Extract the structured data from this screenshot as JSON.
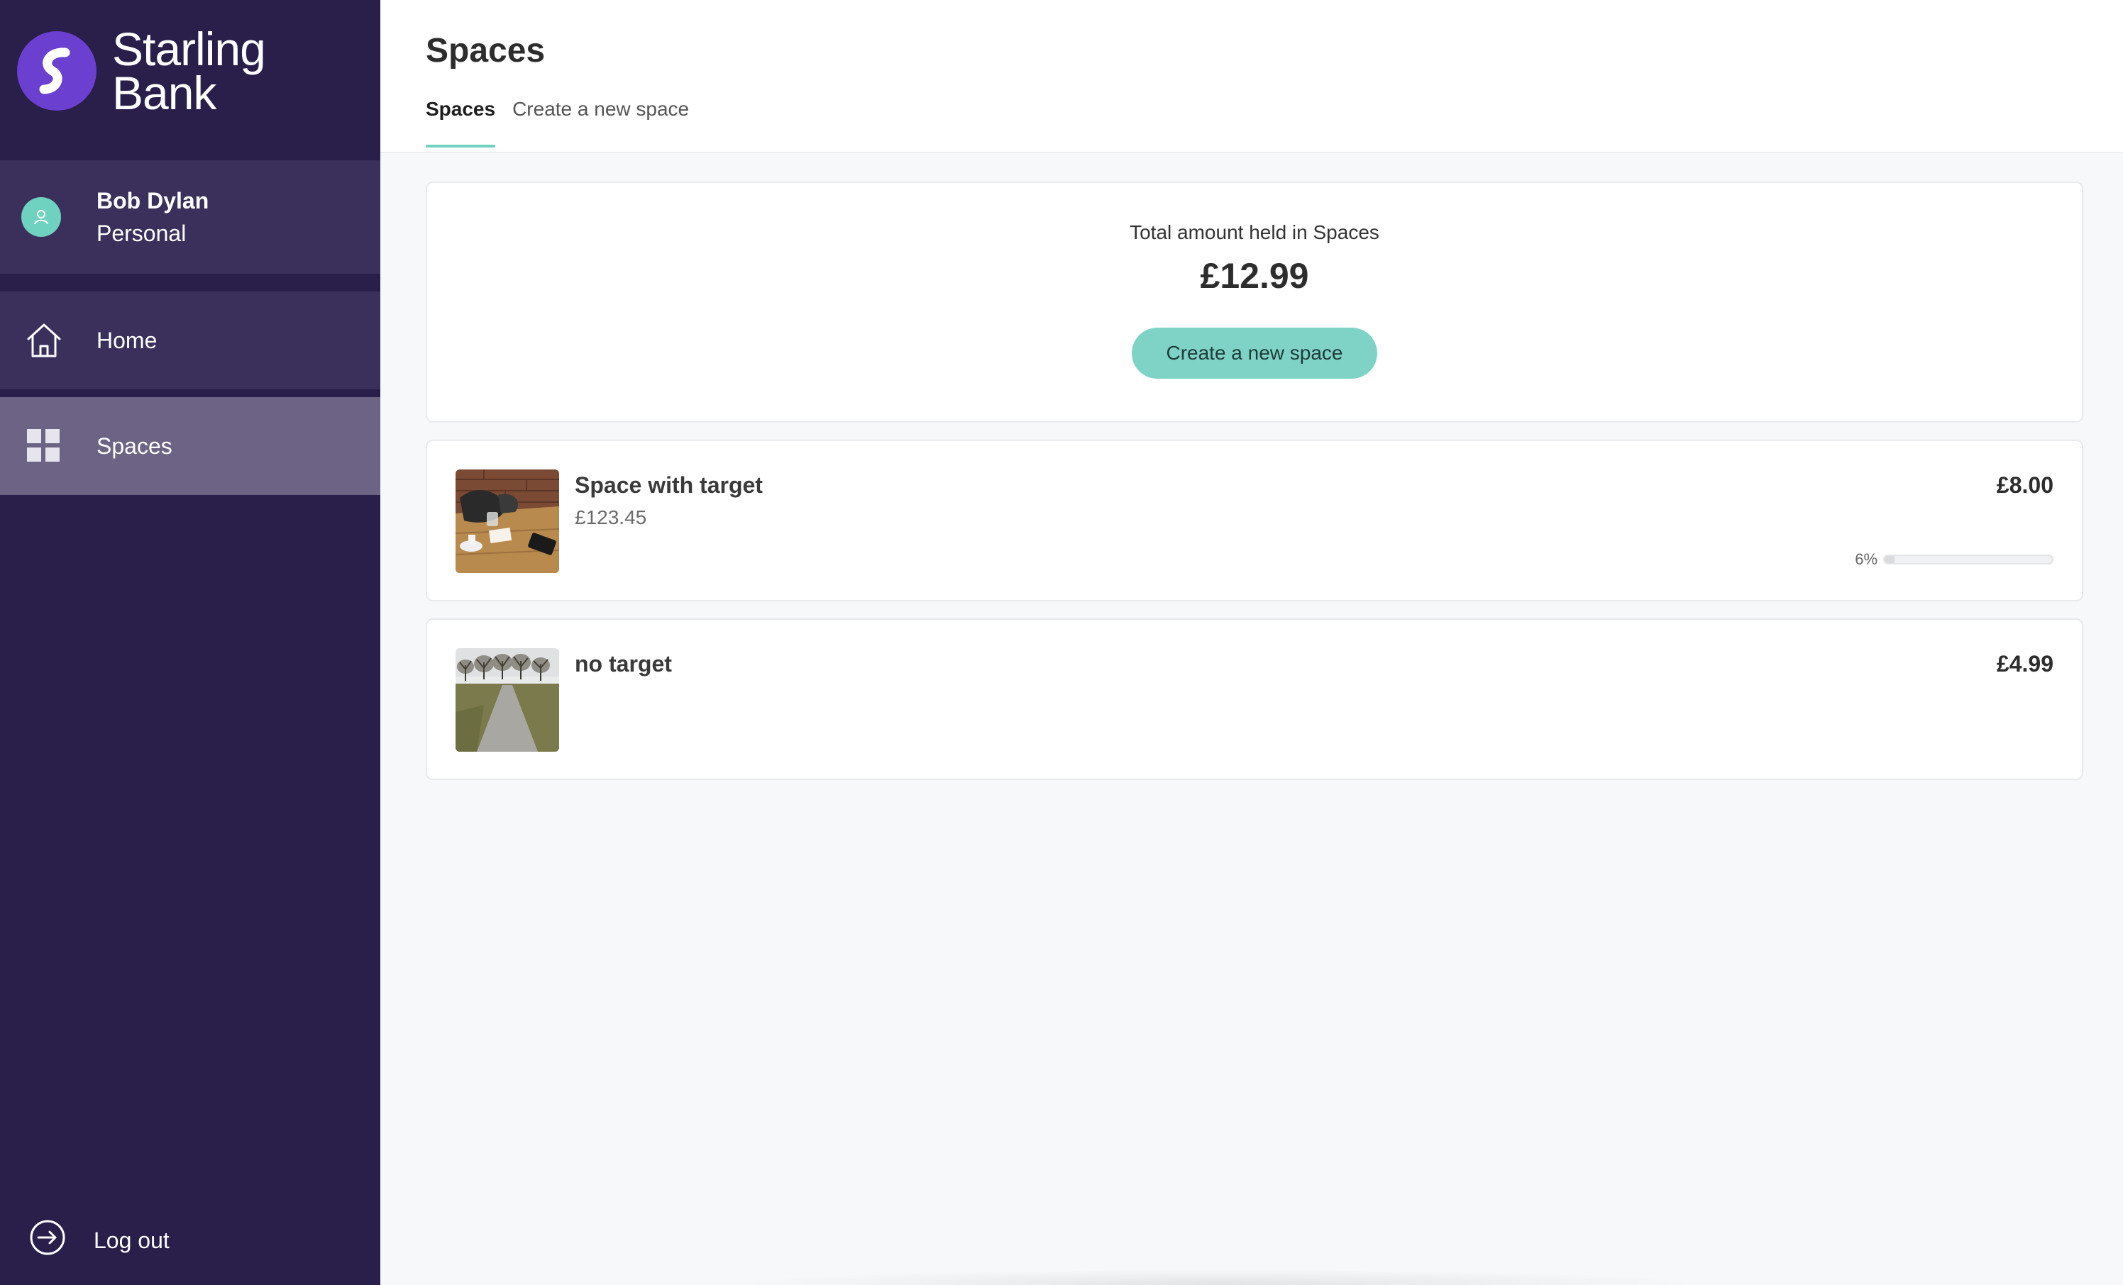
{
  "brand": {
    "line1": "Starling",
    "line2": "Bank"
  },
  "profile": {
    "name": "Bob Dylan",
    "type": "Personal"
  },
  "nav": {
    "home": "Home",
    "spaces": "Spaces",
    "logout": "Log out"
  },
  "page": {
    "title": "Spaces",
    "tabs": [
      "Spaces",
      "Create a new space"
    ]
  },
  "summary": {
    "label": "Total amount held in Spaces",
    "amount": "£12.99",
    "button": "Create a new space"
  },
  "spaces": [
    {
      "name": "Space with target",
      "target": "£123.45",
      "amount": "£8.00",
      "progress_label": "6%",
      "progress": 0.06,
      "image": "desk-with-coffee-and-phone"
    },
    {
      "name": "no target",
      "amount": "£4.99",
      "image": "tree-lined-path"
    }
  ],
  "colors": {
    "sidebar": "#2a1e4a",
    "accent": "#6fd1bf",
    "brand": "#6b3fd0",
    "button": "#7ed3c6"
  }
}
